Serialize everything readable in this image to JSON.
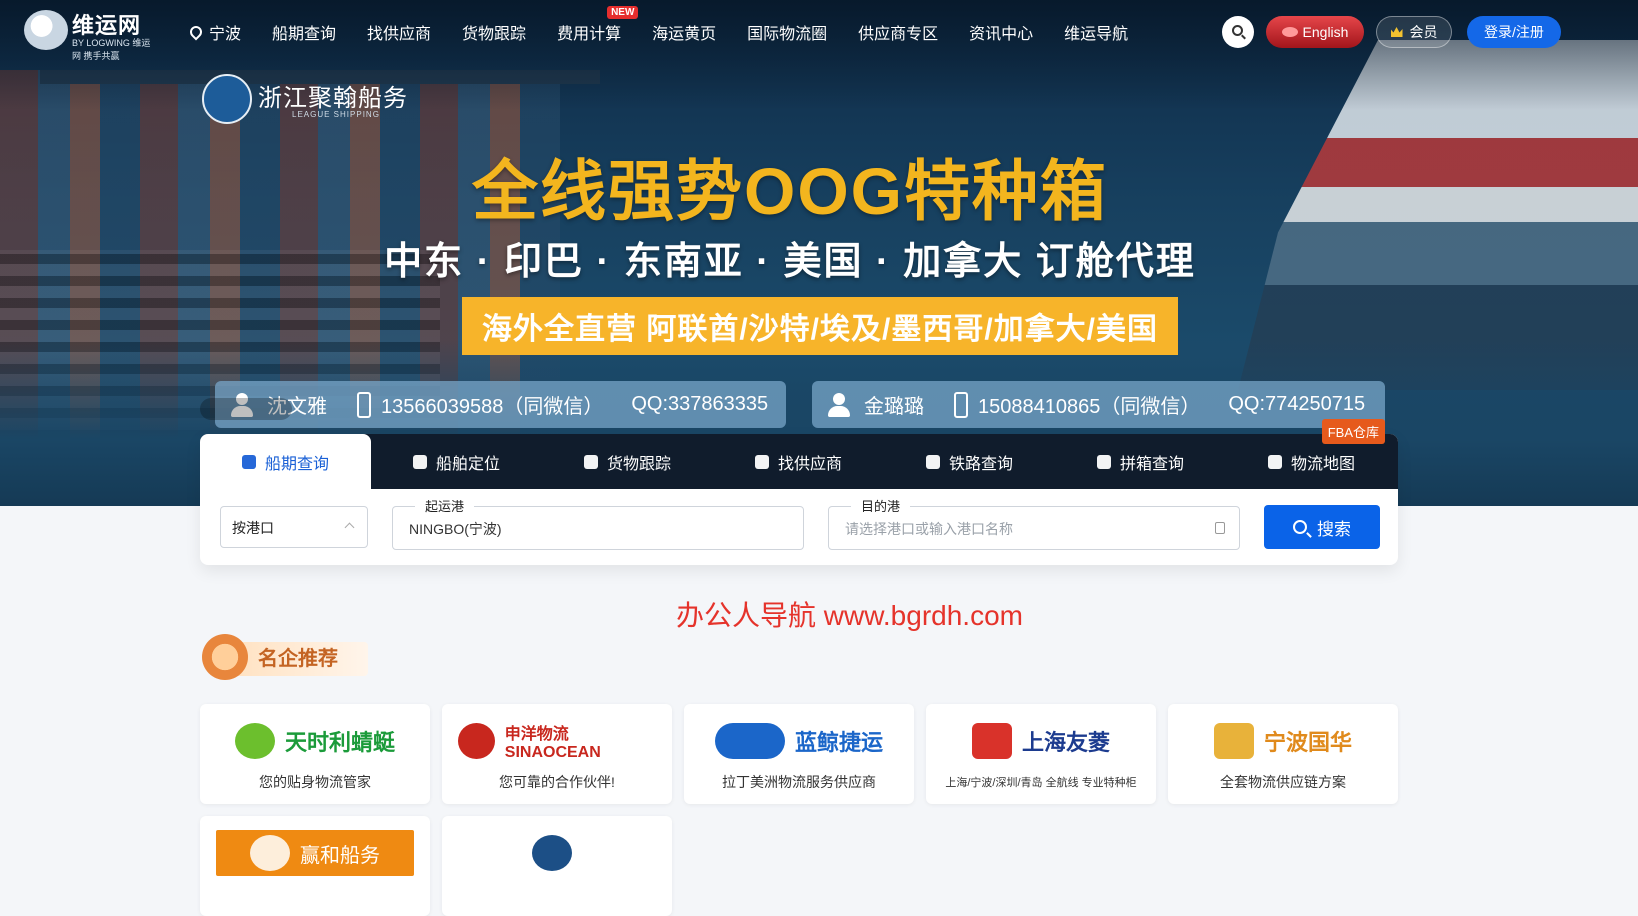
{
  "site": {
    "logo_title": "维运网",
    "logo_sub": "BY LOGWING 维运网 携手共赢"
  },
  "nav": {
    "location": "宁波",
    "items": [
      "船期查询",
      "找供应商",
      "货物跟踪",
      "费用计算",
      "海运黄页",
      "国际物流圈",
      "供应商专区",
      "资讯中心",
      "维运导航"
    ],
    "new_badge": "NEW",
    "english": "English",
    "member": "会员",
    "login": "登录/注册"
  },
  "banner": {
    "company_name": "浙江聚翰船务",
    "company_en": "LEAGUE SHIPPING",
    "headline": "全线强势OOG特种箱",
    "routes": "中东 · 印巴 · 东南亚  · 美国 · 加拿大  订舱代理",
    "strip": "海外全直营 阿联酋/沙特/埃及/墨西哥/加拿大/美国",
    "contacts": [
      {
        "name": "沈文雅",
        "phone": "13566039588（同微信）",
        "qq": "QQ:337863335"
      },
      {
        "name": "金璐璐",
        "phone": "15088410865（同微信）",
        "qq": "QQ:774250715"
      }
    ]
  },
  "search_panel": {
    "tabs": [
      "船期查询",
      "船舶定位",
      "货物跟踪",
      "找供应商",
      "铁路查询",
      "拼箱查询",
      "物流地图"
    ],
    "active_tab": "船期查询",
    "fba_badge": "FBA仓库",
    "mode_select": "按港口",
    "origin_label": "起运港",
    "origin_value": "NINGBO(宁波)",
    "dest_label": "目的港",
    "dest_placeholder": "请选择港口或输入港口名称",
    "search_label": "搜索"
  },
  "watermark": "办公人导航 www.bgrdh.com",
  "featured": {
    "title": "名企推荐",
    "cards": [
      {
        "name": "天时利蜻蜓",
        "desc": "您的贴身物流管家",
        "color": "#1b9b3a"
      },
      {
        "name": "申洋物流 SINAOCEAN",
        "desc": "您可靠的合作伙伴!",
        "color": "#c8271e"
      },
      {
        "name": "蓝鲸捷运",
        "desc": "拉丁美洲物流服务供应商",
        "color": "#1b66c9"
      },
      {
        "name": "上海友菱",
        "desc": "上海/宁波/深圳/青岛 全航线 专业特种柜",
        "color": "#1c3b8f"
      },
      {
        "name": "宁波国华",
        "desc": "全套物流供应链方案",
        "color": "#e08a1c"
      },
      {
        "name": "赢和船务",
        "desc": "",
        "color": "#ef8a12"
      },
      {
        "name": "",
        "desc": "",
        "color": "#1c4f86"
      }
    ]
  }
}
